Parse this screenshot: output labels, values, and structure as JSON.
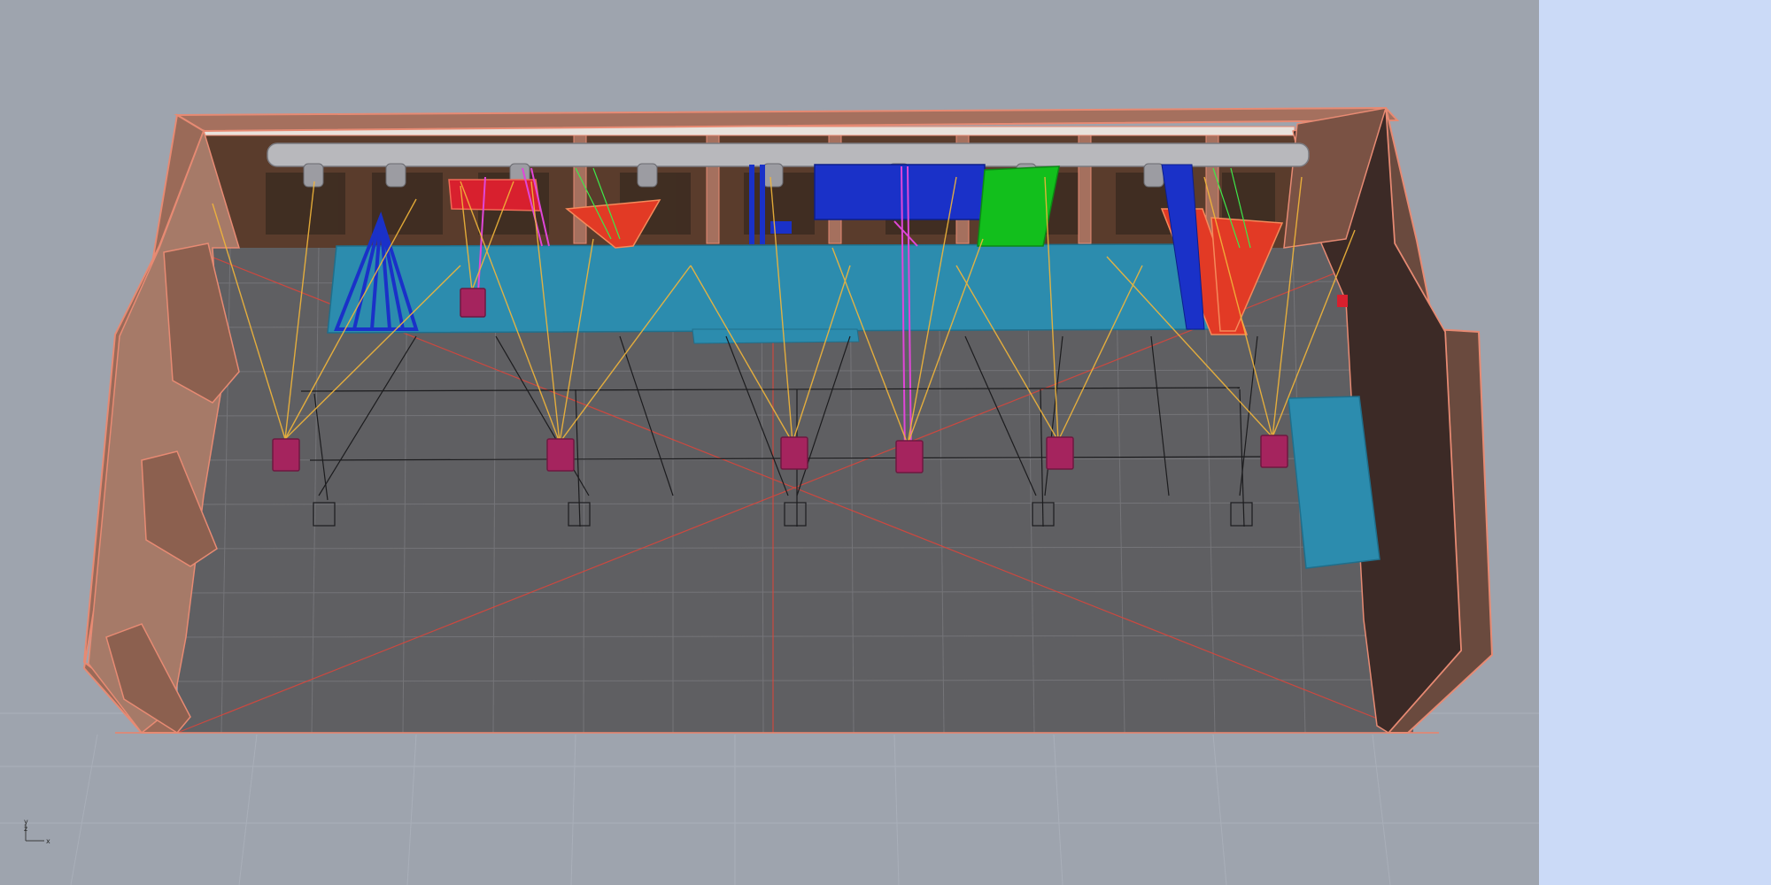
{
  "viewport": {
    "axis": {
      "y_label": "y",
      "z_label": "z",
      "x_label": "x"
    }
  },
  "colors": {
    "background": "#9ea4ae",
    "side_panel": "#cbdaf7",
    "floor": "#5f5f62",
    "wall": "#9e7264",
    "wall_edge": "#e78a73",
    "platform": "#2c8cae",
    "speaker": "#a5245e",
    "light_beam": "#f2b63a",
    "blue_shape": "#1a31c8",
    "red_shape": "#e23a25",
    "green_shape": "#12bf1c",
    "magenta": "#e046d8"
  },
  "icons": {
    "axis_gizmo": "axis-gizmo-icon"
  }
}
